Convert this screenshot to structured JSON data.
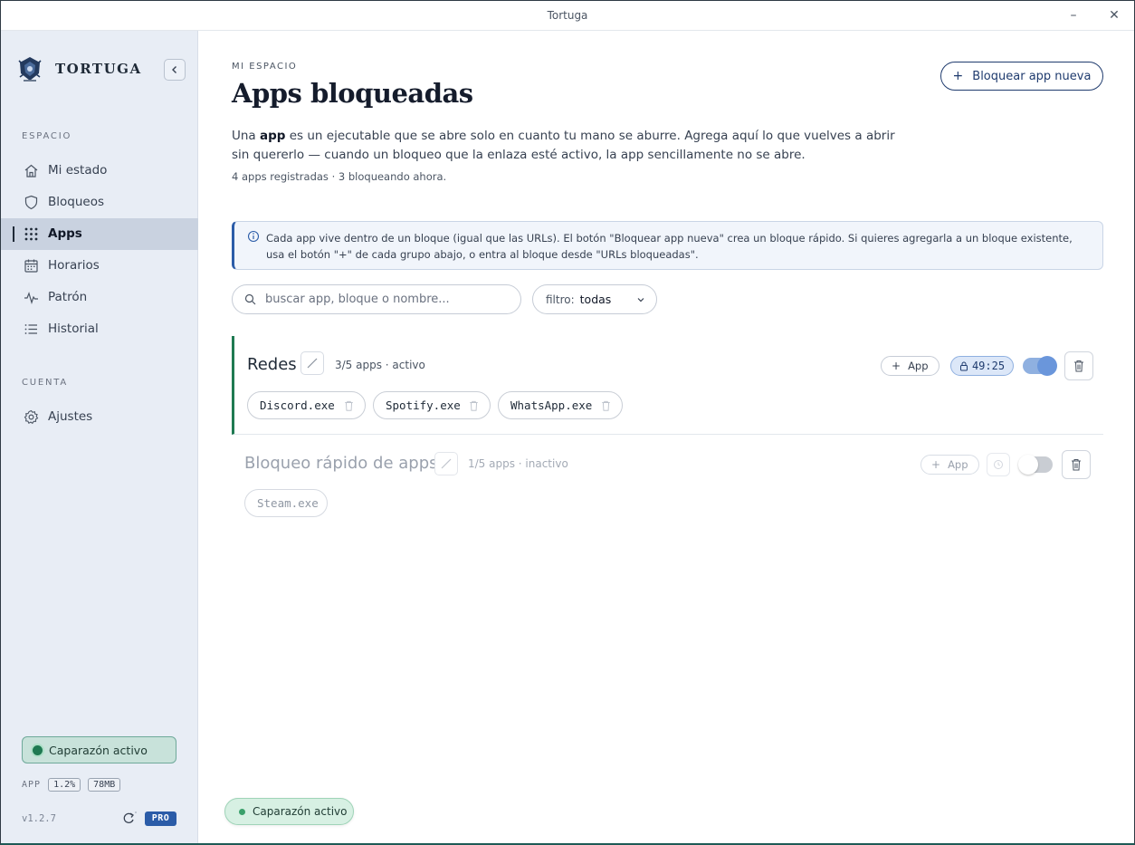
{
  "window": {
    "title": "Tortuga",
    "minimize": "–",
    "close": "✕"
  },
  "sidebar": {
    "brand": "TORTUGA",
    "sections": {
      "space": "ESPACIO",
      "account": "CUENTA"
    },
    "items": [
      {
        "label": "Mi estado",
        "icon": "home-icon"
      },
      {
        "label": "Bloqueos",
        "icon": "shield-icon"
      },
      {
        "label": "Apps",
        "icon": "grid-icon",
        "active": true
      },
      {
        "label": "Horarios",
        "icon": "calendar-icon"
      },
      {
        "label": "Patrón",
        "icon": "pulse-icon"
      },
      {
        "label": "Historial",
        "icon": "list-icon"
      }
    ],
    "account_items": [
      {
        "label": "Ajustes",
        "icon": "gear-icon"
      }
    ],
    "status": "Caparazón activo",
    "usage": {
      "label": "APP",
      "cpu": "1.2%",
      "mem": "78MB"
    },
    "version": "v1.2.7",
    "badge": "PRO"
  },
  "main": {
    "kicker": "MI ESPACIO",
    "title": "Apps bloqueadas",
    "new_button": "Bloquear app nueva",
    "desc_pre": "Una ",
    "desc_bold": "app",
    "desc_post": " es un ejecutable que se abre solo en cuanto tu mano se aburre. Agrega aquí lo que vuelves a abrir sin quererlo — cuando un bloqueo que la enlaza esté activo, la app sencillamente no se abre.",
    "meta": "4 apps registradas · 3 bloqueando ahora.",
    "info": "Cada app vive dentro de un bloque (igual que las URLs). El botón \"Bloquear app nueva\" crea un bloque rápido. Si quieres agregarla a un bloque existente, usa el botón \"+\" de cada grupo abajo, o entra al bloque desde \"URLs bloqueadas\".",
    "search_placeholder": "buscar app, bloque o nombre...",
    "filter_label": "filtro:",
    "filter_value": "todas",
    "groups": [
      {
        "name": "Redes",
        "meta": "3/5 apps · activo",
        "add": "App",
        "timer": "49:25",
        "enabled": true,
        "apps": [
          "Discord.exe",
          "Spotify.exe",
          "WhatsApp.exe"
        ]
      },
      {
        "name": "Bloqueo rápido de apps",
        "meta": "1/5 apps · inactivo",
        "add": "App",
        "enabled": false,
        "apps": [
          "Steam.exe"
        ]
      }
    ],
    "toast": "Caparazón activo"
  },
  "colors": {
    "accent": "#1f3b6e",
    "active_green": "#1f7a52",
    "sidebar_bg": "#e8edf5",
    "pro": "#2b5ca8"
  }
}
